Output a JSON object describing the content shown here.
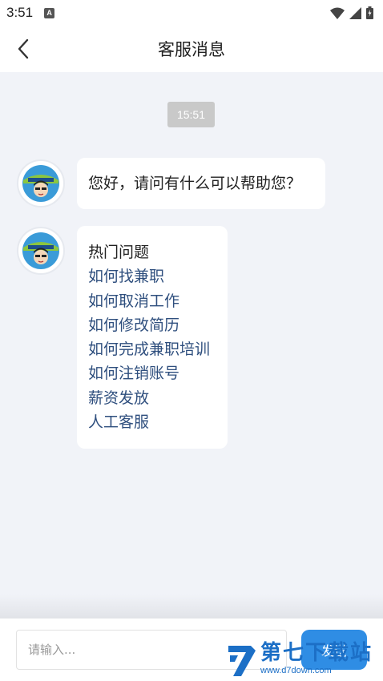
{
  "status_bar": {
    "time": "3:51",
    "notification_icon": "A"
  },
  "header": {
    "title": "客服消息"
  },
  "chat": {
    "timestamp": "15:51",
    "messages": [
      {
        "sender": "service",
        "text": "您好，请问有什么可以帮助您？"
      },
      {
        "sender": "service",
        "title": "热门问题",
        "faq_items": [
          "如何找兼职",
          "如何取消工作",
          "如何修改简历",
          "如何完成兼职培训",
          "如何注销账号",
          "薪资发放",
          "人工客服"
        ]
      }
    ]
  },
  "input_bar": {
    "placeholder": "请输入...",
    "send_label": "发送"
  },
  "watermark": {
    "brand": "第七下载站",
    "url": "www.d7down.com"
  },
  "colors": {
    "chat_bg": "#f1f3f8",
    "link_text": "#2f4f7e",
    "send_button": "#2f8de4",
    "timestamp_bg": "#c9c9c9"
  }
}
